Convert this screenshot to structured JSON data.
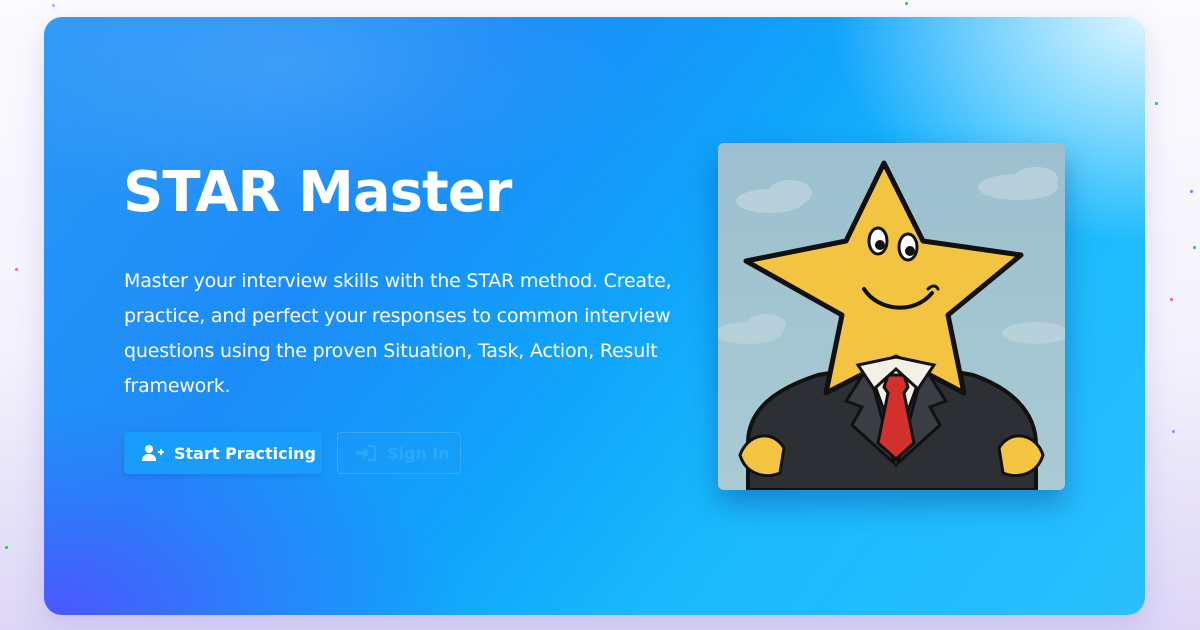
{
  "hero": {
    "title": "STAR Master",
    "description": "Master your interview skills with the STAR method. Create, practice, and perfect your responses to common interview questions using the proven Situation, Task, Action, Result framework.",
    "primary_button": {
      "label": "Start Practicing",
      "icon": "user-plus-icon"
    },
    "secondary_button": {
      "label": "Sign In",
      "icon": "sign-in-icon"
    },
    "illustration": {
      "subject": "star mascot in business suit",
      "icon": "star-mascot-illustration"
    }
  },
  "colors": {
    "primary_button": "#1a9cfb",
    "secondary_button_text": "#2aa9ff",
    "card_gradient_start": "#2b97f6",
    "card_gradient_end": "#29bffc",
    "accent_purple": "#5c46ff"
  }
}
